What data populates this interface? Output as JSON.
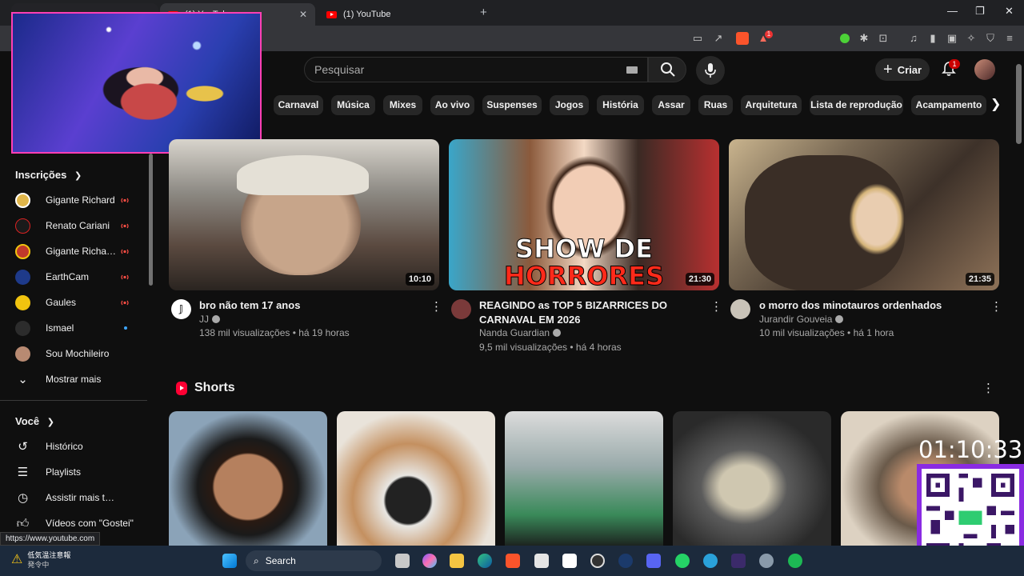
{
  "browser": {
    "tabs": [
      {
        "label": "",
        "active": false
      },
      {
        "label": "(1) YouTube",
        "active": true
      },
      {
        "label": "(1) YouTube",
        "active": false
      }
    ],
    "new_tab": "+",
    "extension_badge": "1"
  },
  "header": {
    "search_placeholder": "Pesquisar",
    "create_label": "Criar",
    "notification_count": "1"
  },
  "chips": [
    "Carnaval",
    "Música",
    "Mixes",
    "Ao vivo",
    "Suspenses",
    "Jogos",
    "História",
    "Assar",
    "Ruas",
    "Arquitetura",
    "Lista de reprodução",
    "Acampamento"
  ],
  "sidebar": {
    "subscriptions_heading": "Inscrições",
    "subscriptions": [
      {
        "label": "Gigante Richard",
        "status": "live"
      },
      {
        "label": "Renato Cariani",
        "status": "live"
      },
      {
        "label": "Gigante Richard ...",
        "status": "live"
      },
      {
        "label": "EarthCam",
        "status": "live"
      },
      {
        "label": "Gaules",
        "status": "live"
      },
      {
        "label": "Ismael",
        "status": "new"
      },
      {
        "label": "Sou Mochileiro",
        "status": "none"
      }
    ],
    "show_more": "Mostrar mais",
    "you_heading": "Você",
    "you_items": [
      {
        "label": "Histórico",
        "icon": "history-icon"
      },
      {
        "label": "Playlists",
        "icon": "playlist-icon"
      },
      {
        "label": "Assistir mais tarde",
        "icon": "clock-icon"
      },
      {
        "label": "Vídeos com \"Gostei\"",
        "icon": "thumb-up-icon"
      }
    ]
  },
  "videos": [
    {
      "title": "bro não tem 17 anos",
      "channel": "JJ",
      "meta": "138 mil visualizações • há 19 horas",
      "duration": "10:10"
    },
    {
      "title": "REAGINDO as TOP 5 BIZARRICES DO CARNAVAL EM 2026",
      "channel": "Nanda Guardian",
      "meta": "9,5 mil visualizações • há 4 horas",
      "duration": "21:30",
      "thumb_text": [
        "SHOW DE",
        "HORRORES"
      ]
    },
    {
      "title": "o morro dos minotauros ordenhados",
      "channel": "Jurandir Gouveia",
      "meta": "10 mil visualizações • há 1 hora",
      "duration": "21:35"
    }
  ],
  "shorts": {
    "heading": "Shorts"
  },
  "overlay": {
    "timer": "01:10:33",
    "status_url": "https://www.youtube.com"
  },
  "taskbar": {
    "search": "Search",
    "weather_line1": "低気温注意報",
    "weather_line2": "発令中"
  }
}
